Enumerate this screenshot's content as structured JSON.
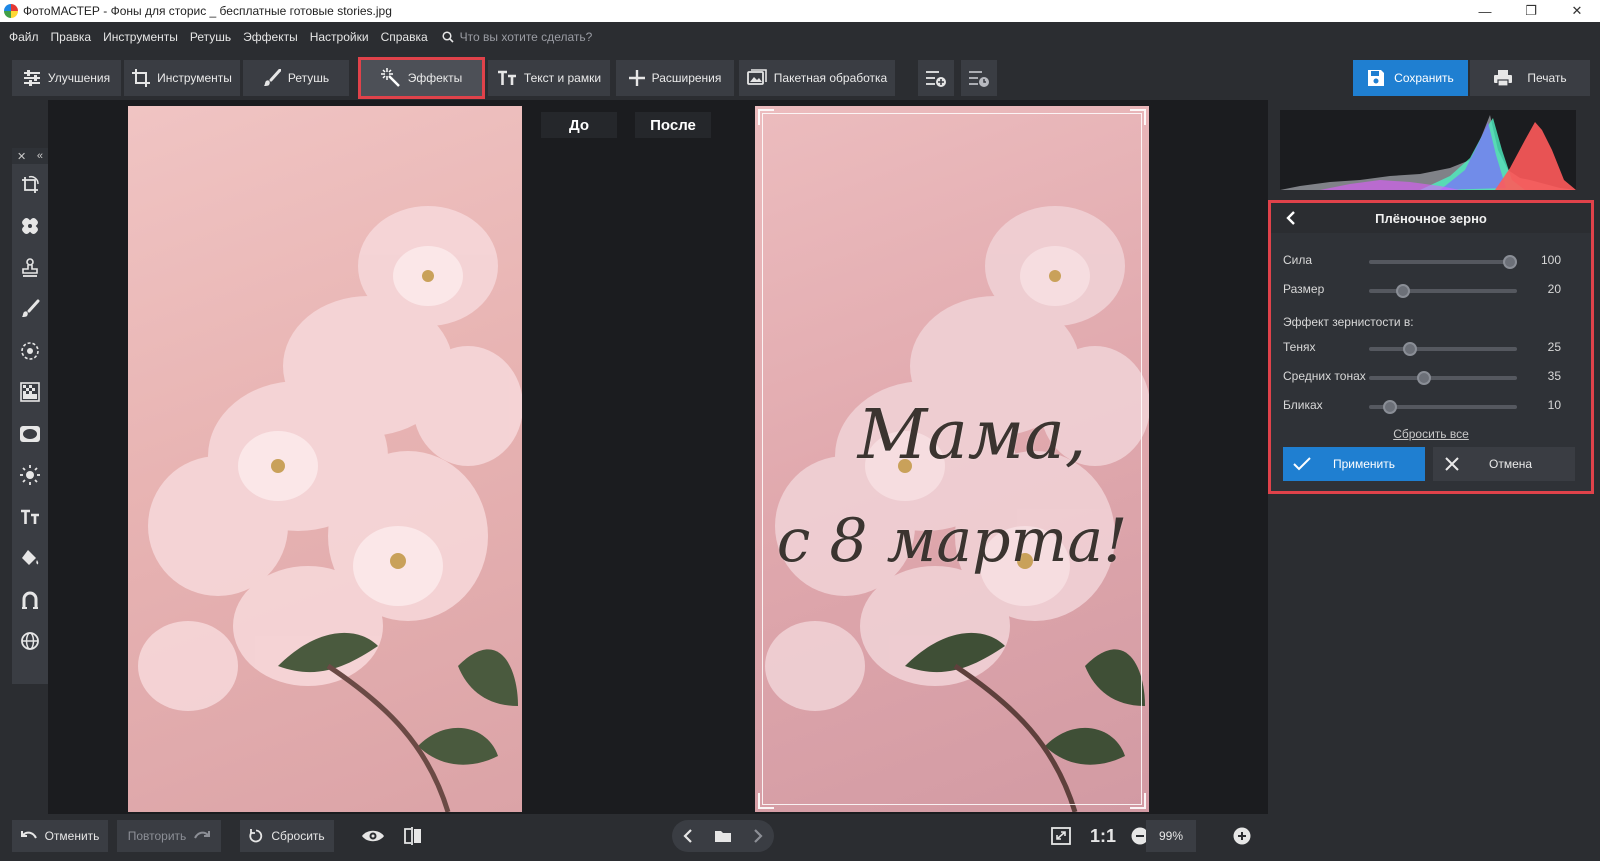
{
  "window": {
    "title": "ФотоМАСТЕР - Фоны для сторис _ бесплатные готовые stories.jpg",
    "controls": [
      "—",
      "❐",
      "✕"
    ]
  },
  "menu": {
    "items": [
      "Файл",
      "Правка",
      "Инструменты",
      "Ретушь",
      "Эффекты",
      "Настройки",
      "Справка"
    ],
    "search_placeholder": "Что вы хотите сделать?"
  },
  "toolbar": {
    "tabs": [
      {
        "label": "Улучшения",
        "icon": "sliders-icon"
      },
      {
        "label": "Инструменты",
        "icon": "crop-icon"
      },
      {
        "label": "Ретушь",
        "icon": "brush-icon"
      },
      {
        "label": "Эффекты",
        "icon": "magic-wand-icon",
        "active": true
      },
      {
        "label": "Текст и рамки",
        "icon": "text-icon"
      },
      {
        "label": "Расширения",
        "icon": "plus-icon"
      },
      {
        "label": "Пакетная обработка",
        "icon": "images-icon"
      }
    ],
    "save_label": "Сохранить",
    "print_label": "Печать"
  },
  "compare": {
    "before_label": "До",
    "after_label": "После",
    "greeting_line1": "Мама,",
    "greeting_line2": "с 8 марта!"
  },
  "effect_panel": {
    "title": "Плёночное зерно",
    "sliders": [
      {
        "label": "Сила",
        "value": 100,
        "fraction": 1.0
      },
      {
        "label": "Размер",
        "value": 20,
        "fraction": 0.2
      }
    ],
    "grain_subhead": "Эффект зернистости в:",
    "tone_sliders": [
      {
        "label": "Тенях",
        "value": 25,
        "fraction": 0.25
      },
      {
        "label": "Средних тонах",
        "value": 35,
        "fraction": 0.35
      },
      {
        "label": "Бликах",
        "value": 10,
        "fraction": 0.1
      }
    ],
    "reset_label": "Сбросить все",
    "apply_label": "Применить",
    "cancel_label": "Отмена"
  },
  "bottom": {
    "undo_label": "Отменить",
    "redo_label": "Повторить",
    "reset_label": "Сбросить",
    "zoom_one": "1:1",
    "zoom_value": "99%"
  },
  "colors": {
    "accent": "#1f7fd1",
    "highlight": "#e0424a",
    "background": "#2b2d31"
  }
}
